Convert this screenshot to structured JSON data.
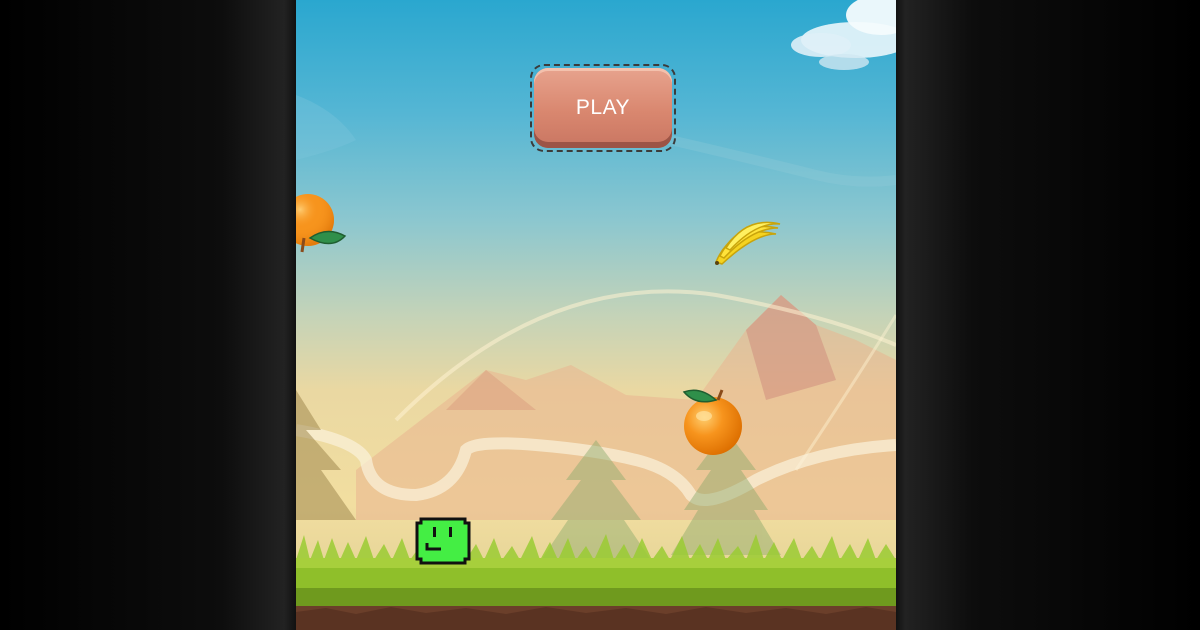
{
  "menu": {
    "play_label": "PLAY"
  },
  "colors": {
    "sky_top": "#2aa7cf",
    "sky_bottom": "#f2dea0",
    "grass": "#8fbf2a",
    "button": "#d9876f",
    "player": "#44ee44"
  },
  "sprites": {
    "player": "green-cube-player",
    "collectibles": [
      "orange-fruit",
      "banana-fruit",
      "orange-fruit"
    ]
  }
}
